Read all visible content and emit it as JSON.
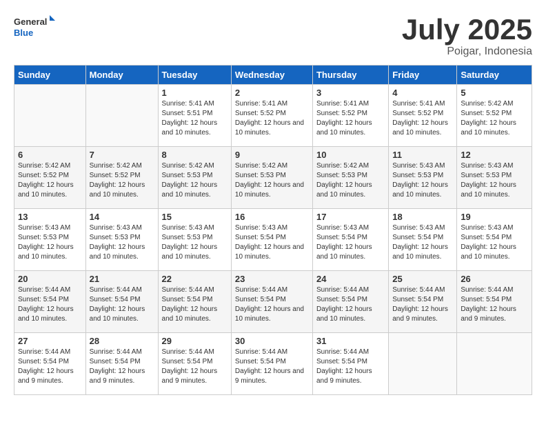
{
  "header": {
    "logo_general": "General",
    "logo_blue": "Blue",
    "title": "July 2025",
    "subtitle": "Poigar, Indonesia"
  },
  "weekdays": [
    "Sunday",
    "Monday",
    "Tuesday",
    "Wednesday",
    "Thursday",
    "Friday",
    "Saturday"
  ],
  "weeks": [
    [
      {
        "day": "",
        "info": ""
      },
      {
        "day": "",
        "info": ""
      },
      {
        "day": "1",
        "info": "Sunrise: 5:41 AM\nSunset: 5:51 PM\nDaylight: 12 hours and 10 minutes."
      },
      {
        "day": "2",
        "info": "Sunrise: 5:41 AM\nSunset: 5:52 PM\nDaylight: 12 hours and 10 minutes."
      },
      {
        "day": "3",
        "info": "Sunrise: 5:41 AM\nSunset: 5:52 PM\nDaylight: 12 hours and 10 minutes."
      },
      {
        "day": "4",
        "info": "Sunrise: 5:41 AM\nSunset: 5:52 PM\nDaylight: 12 hours and 10 minutes."
      },
      {
        "day": "5",
        "info": "Sunrise: 5:42 AM\nSunset: 5:52 PM\nDaylight: 12 hours and 10 minutes."
      }
    ],
    [
      {
        "day": "6",
        "info": "Sunrise: 5:42 AM\nSunset: 5:52 PM\nDaylight: 12 hours and 10 minutes."
      },
      {
        "day": "7",
        "info": "Sunrise: 5:42 AM\nSunset: 5:52 PM\nDaylight: 12 hours and 10 minutes."
      },
      {
        "day": "8",
        "info": "Sunrise: 5:42 AM\nSunset: 5:53 PM\nDaylight: 12 hours and 10 minutes."
      },
      {
        "day": "9",
        "info": "Sunrise: 5:42 AM\nSunset: 5:53 PM\nDaylight: 12 hours and 10 minutes."
      },
      {
        "day": "10",
        "info": "Sunrise: 5:42 AM\nSunset: 5:53 PM\nDaylight: 12 hours and 10 minutes."
      },
      {
        "day": "11",
        "info": "Sunrise: 5:43 AM\nSunset: 5:53 PM\nDaylight: 12 hours and 10 minutes."
      },
      {
        "day": "12",
        "info": "Sunrise: 5:43 AM\nSunset: 5:53 PM\nDaylight: 12 hours and 10 minutes."
      }
    ],
    [
      {
        "day": "13",
        "info": "Sunrise: 5:43 AM\nSunset: 5:53 PM\nDaylight: 12 hours and 10 minutes."
      },
      {
        "day": "14",
        "info": "Sunrise: 5:43 AM\nSunset: 5:53 PM\nDaylight: 12 hours and 10 minutes."
      },
      {
        "day": "15",
        "info": "Sunrise: 5:43 AM\nSunset: 5:53 PM\nDaylight: 12 hours and 10 minutes."
      },
      {
        "day": "16",
        "info": "Sunrise: 5:43 AM\nSunset: 5:54 PM\nDaylight: 12 hours and 10 minutes."
      },
      {
        "day": "17",
        "info": "Sunrise: 5:43 AM\nSunset: 5:54 PM\nDaylight: 12 hours and 10 minutes."
      },
      {
        "day": "18",
        "info": "Sunrise: 5:43 AM\nSunset: 5:54 PM\nDaylight: 12 hours and 10 minutes."
      },
      {
        "day": "19",
        "info": "Sunrise: 5:43 AM\nSunset: 5:54 PM\nDaylight: 12 hours and 10 minutes."
      }
    ],
    [
      {
        "day": "20",
        "info": "Sunrise: 5:44 AM\nSunset: 5:54 PM\nDaylight: 12 hours and 10 minutes."
      },
      {
        "day": "21",
        "info": "Sunrise: 5:44 AM\nSunset: 5:54 PM\nDaylight: 12 hours and 10 minutes."
      },
      {
        "day": "22",
        "info": "Sunrise: 5:44 AM\nSunset: 5:54 PM\nDaylight: 12 hours and 10 minutes."
      },
      {
        "day": "23",
        "info": "Sunrise: 5:44 AM\nSunset: 5:54 PM\nDaylight: 12 hours and 10 minutes."
      },
      {
        "day": "24",
        "info": "Sunrise: 5:44 AM\nSunset: 5:54 PM\nDaylight: 12 hours and 10 minutes."
      },
      {
        "day": "25",
        "info": "Sunrise: 5:44 AM\nSunset: 5:54 PM\nDaylight: 12 hours and 9 minutes."
      },
      {
        "day": "26",
        "info": "Sunrise: 5:44 AM\nSunset: 5:54 PM\nDaylight: 12 hours and 9 minutes."
      }
    ],
    [
      {
        "day": "27",
        "info": "Sunrise: 5:44 AM\nSunset: 5:54 PM\nDaylight: 12 hours and 9 minutes."
      },
      {
        "day": "28",
        "info": "Sunrise: 5:44 AM\nSunset: 5:54 PM\nDaylight: 12 hours and 9 minutes."
      },
      {
        "day": "29",
        "info": "Sunrise: 5:44 AM\nSunset: 5:54 PM\nDaylight: 12 hours and 9 minutes."
      },
      {
        "day": "30",
        "info": "Sunrise: 5:44 AM\nSunset: 5:54 PM\nDaylight: 12 hours and 9 minutes."
      },
      {
        "day": "31",
        "info": "Sunrise: 5:44 AM\nSunset: 5:54 PM\nDaylight: 12 hours and 9 minutes."
      },
      {
        "day": "",
        "info": ""
      },
      {
        "day": "",
        "info": ""
      }
    ]
  ]
}
